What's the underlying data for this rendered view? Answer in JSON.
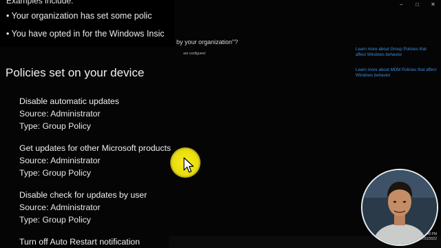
{
  "window": {
    "controls": [
      "–",
      "□",
      "✕"
    ]
  },
  "zoom": {
    "examples_heading": "Examples include:",
    "bullets": [
      "• Your organization has set some polic",
      "• You have opted in for the Windows Insic"
    ]
  },
  "background": {
    "question": "by your organization\"?",
    "configured_note": "are configured"
  },
  "side_links": [
    "Learn more about Group Policies that affect Windows behavior",
    "Learn more about MDM Policies that affect Windows behavior"
  ],
  "section_title": "Policies set on your device",
  "policies": [
    {
      "name": "Disable automatic updates",
      "source": "Source: Administrator",
      "type": "Type: Group Policy"
    },
    {
      "name": "Get updates for other Microsoft products",
      "source": "Source: Administrator",
      "type": "Type: Group Policy"
    },
    {
      "name": "Disable check for updates by user",
      "source": "Source: Administrator",
      "type": "Type: Group Policy"
    },
    {
      "name": "Turn off Auto Restart notification",
      "source": "",
      "type": ""
    }
  ],
  "clock": {
    "time": "3:49 PM",
    "date": "7/31/2022"
  },
  "colors": {
    "link": "#3a8fe0",
    "cursor_highlight": "#f6ef1c"
  }
}
